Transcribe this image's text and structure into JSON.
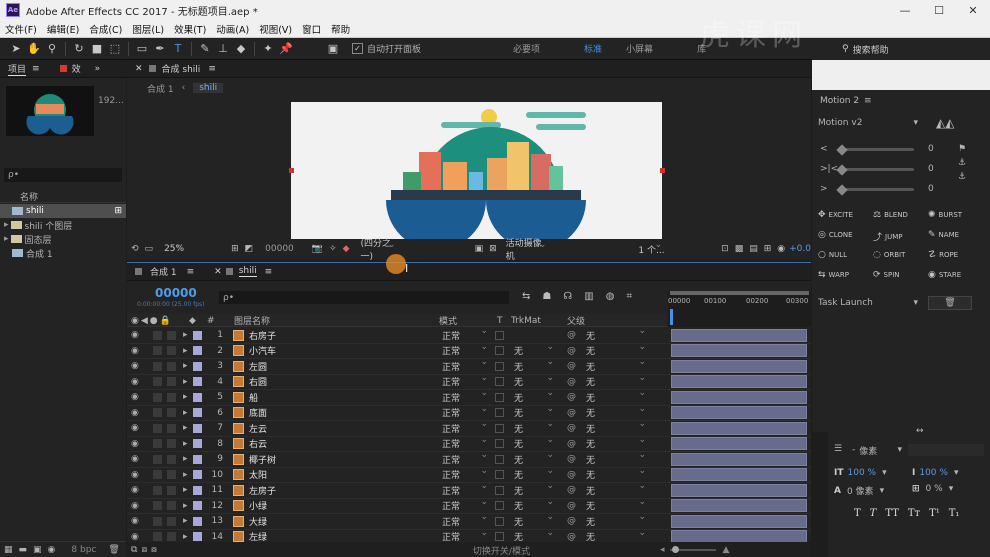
{
  "window": {
    "title": "Adobe After Effects CC 2017 - 无标题项目.aep *",
    "logo": "Ae"
  },
  "menu": [
    "文件(F)",
    "编辑(E)",
    "合成(C)",
    "图层(L)",
    "效果(T)",
    "动画(A)",
    "视图(V)",
    "窗口",
    "帮助"
  ],
  "toolbar": {
    "auto_open_label": "自动打开面板",
    "workspaces": [
      "必要项",
      "标准",
      "小屏幕",
      "库"
    ],
    "active_workspace": "标准",
    "search_placeholder": "搜索帮助"
  },
  "watermark": "虎课网",
  "project": {
    "tab": "项目",
    "tab2": "效",
    "thumb_info": "192...",
    "search_placeholder": "ρ•",
    "col_name": "名称",
    "items": [
      {
        "name": "shili",
        "type": "comp",
        "selected": true
      },
      {
        "name": "shili 个图层",
        "type": "folder"
      },
      {
        "name": "固态层",
        "type": "folder"
      },
      {
        "name": "合成 1",
        "type": "comp"
      }
    ],
    "bpc": "8 bpc"
  },
  "viewer": {
    "tab": "合成 shili",
    "breadcrumbs": [
      "合成 1",
      "shili"
    ],
    "zoom": "25%",
    "timecode": "00000",
    "resolution": "(四分之一)",
    "camera": "活动摄像机",
    "views": "1 个...",
    "exposure": "+0.0"
  },
  "timeline": {
    "tabs": [
      "合成 1",
      "shili"
    ],
    "current_time": "00000",
    "current_time_sub": "0:00:00:00 (25.00 fps)",
    "search_placeholder": "ρ•",
    "headers": {
      "num": "#",
      "name": "图层名称",
      "mode": "模式",
      "t": "T",
      "trkmat": "TrkMat",
      "parent": "父级"
    },
    "ruler": [
      "00000",
      "00100",
      "00200",
      "00300"
    ],
    "footer": "切换开关/模式",
    "layers": [
      {
        "num": "1",
        "name": "右房子",
        "mode": "正常",
        "trkmat": "",
        "parent": "无"
      },
      {
        "num": "2",
        "name": "小汽车",
        "mode": "正常",
        "trkmat": "无",
        "parent": "无"
      },
      {
        "num": "3",
        "name": "左圆",
        "mode": "正常",
        "trkmat": "无",
        "parent": "无"
      },
      {
        "num": "4",
        "name": "右圆",
        "mode": "正常",
        "trkmat": "无",
        "parent": "无"
      },
      {
        "num": "5",
        "name": "船",
        "mode": "正常",
        "trkmat": "无",
        "parent": "无"
      },
      {
        "num": "6",
        "name": "底面",
        "mode": "正常",
        "trkmat": "无",
        "parent": "无"
      },
      {
        "num": "7",
        "name": "左云",
        "mode": "正常",
        "trkmat": "无",
        "parent": "无"
      },
      {
        "num": "8",
        "name": "右云",
        "mode": "正常",
        "trkmat": "无",
        "parent": "无"
      },
      {
        "num": "9",
        "name": "椰子树",
        "mode": "正常",
        "trkmat": "无",
        "parent": "无"
      },
      {
        "num": "10",
        "name": "太阳",
        "mode": "正常",
        "trkmat": "无",
        "parent": "无"
      },
      {
        "num": "11",
        "name": "左房子",
        "mode": "正常",
        "trkmat": "无",
        "parent": "无"
      },
      {
        "num": "12",
        "name": "小绿",
        "mode": "正常",
        "trkmat": "无",
        "parent": "无"
      },
      {
        "num": "13",
        "name": "大绿",
        "mode": "正常",
        "trkmat": "无",
        "parent": "无"
      },
      {
        "num": "14",
        "name": "左绿",
        "mode": "正常",
        "trkmat": "无",
        "parent": "无"
      }
    ]
  },
  "motion": {
    "title": "Motion 2",
    "version": "Motion v2",
    "sliders": [
      {
        "label": "<",
        "value": "0"
      },
      {
        "label": ">|<",
        "value": "0"
      },
      {
        "label": ">",
        "value": "0"
      }
    ],
    "buttons": [
      "EXCITE",
      "BLEND",
      "BURST",
      "CLONE",
      "JUMP",
      "NAME",
      "NULL",
      "ORBIT",
      "ROPE",
      "WARP",
      "SPIN",
      "STARE"
    ],
    "task": "Task Launch"
  },
  "paragraph": {
    "unit": "像素",
    "scale_v": "100 %",
    "scale_h": "100 %",
    "baseline": "0 像素",
    "tsume": "0 %",
    "styles": [
      "T",
      "T",
      "TT",
      "Tт",
      "T¹",
      "T₁"
    ]
  }
}
